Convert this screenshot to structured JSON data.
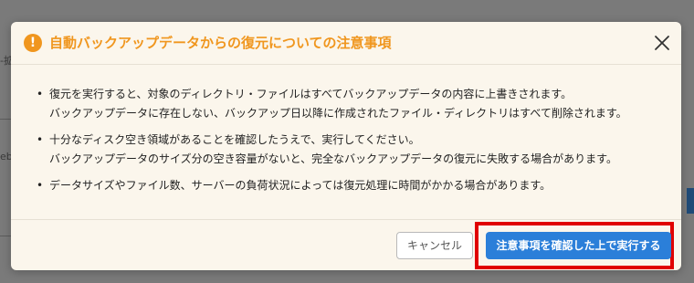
{
  "background": {
    "fragment_a": "-拡",
    "fragment_b": "eb"
  },
  "modal": {
    "title": "自動バックアップデータからの復元についての注意事項",
    "title_icon": "warning-circle-icon",
    "title_color": "#f0961e",
    "close_icon": "close-icon",
    "notes": [
      {
        "bullet": "•",
        "lines": [
          "復元を実行すると、対象のディレクトリ・ファイルはすべてバックアップデータの内容に上書きされます。",
          "バックアップデータに存在しない、バックアップ日以降に作成されたファイル・ディレクトリはすべて削除されます。"
        ]
      },
      {
        "bullet": "•",
        "lines": [
          "十分なディスク空き領域があることを確認したうえで、実行してください。",
          "バックアップデータのサイズ分の空き容量がないと、完全なバックアップデータの復元に失敗する場合があります。"
        ]
      },
      {
        "bullet": "•",
        "lines": [
          "データサイズやファイル数、サーバーの負荷状況によっては復元処理に時間がかかる場合があります。"
        ]
      }
    ],
    "footer": {
      "cancel_label": "キャンセル",
      "confirm_label": "注意事項を確認した上で実行する",
      "confirm_color": "#2b7fd9",
      "highlight_color": "#e00000"
    }
  }
}
